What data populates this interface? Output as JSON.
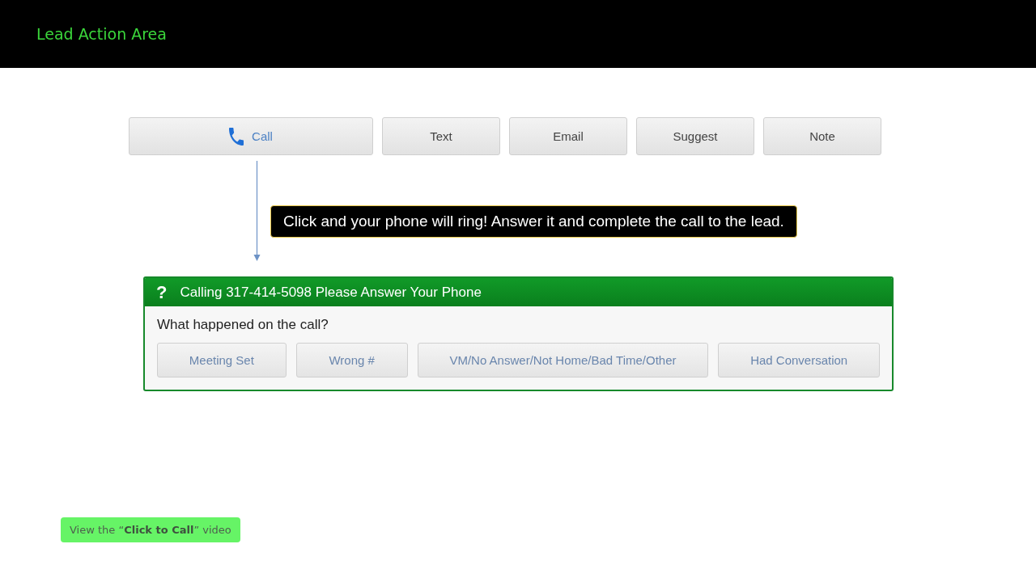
{
  "header": {
    "title": "Lead Action Area"
  },
  "actions": [
    {
      "label": "Call",
      "kind": "call",
      "selected": true
    },
    {
      "label": "Text",
      "kind": "plain",
      "selected": false
    },
    {
      "label": "Email",
      "kind": "plain",
      "selected": false
    },
    {
      "label": "Suggest",
      "kind": "plain",
      "selected": false
    },
    {
      "label": "Note",
      "kind": "plain",
      "selected": false
    }
  ],
  "callout": {
    "text": "Click and your phone will ring! Answer it and complete the call to the lead."
  },
  "panel": {
    "icon": "?",
    "title": "Calling 317-414-5098 Please Answer Your Phone",
    "question": "What happened on the call?",
    "outcomes": [
      "Meeting Set",
      "Wrong #",
      "VM/No Answer/Not Home/Bad Time/Other",
      "Had Conversation"
    ]
  },
  "video_link": {
    "text": "View the “**Click to Call**” video"
  }
}
